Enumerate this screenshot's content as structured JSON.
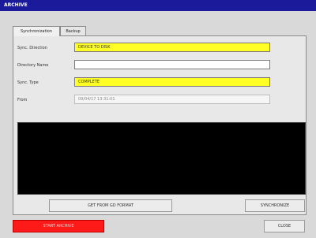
{
  "window": {
    "title": "ARCHIVE"
  },
  "tabs": [
    {
      "label": "Synchronization"
    },
    {
      "label": "Backup"
    }
  ],
  "form": {
    "sync_direction": {
      "label": "Sync. Direction",
      "value": "DEVICE TO DISK"
    },
    "directory_name": {
      "label": "Directory Name",
      "value": ""
    },
    "sync_type": {
      "label": "Sync. Type",
      "value": "COMPLETE"
    },
    "from": {
      "label": "From",
      "value": "09/04/17 13:31:01"
    }
  },
  "buttons": {
    "get_from_gd": "GET FROM GD FORMAT",
    "synchronize": "SYNCHRONIZE",
    "start_archive": "START ARCHIVE",
    "close": "CLOSE"
  },
  "colors": {
    "title_bar": "#1a1a9a",
    "field_highlight": "#ffff26",
    "console": "#000000",
    "start_button": "#ff1a1a"
  }
}
